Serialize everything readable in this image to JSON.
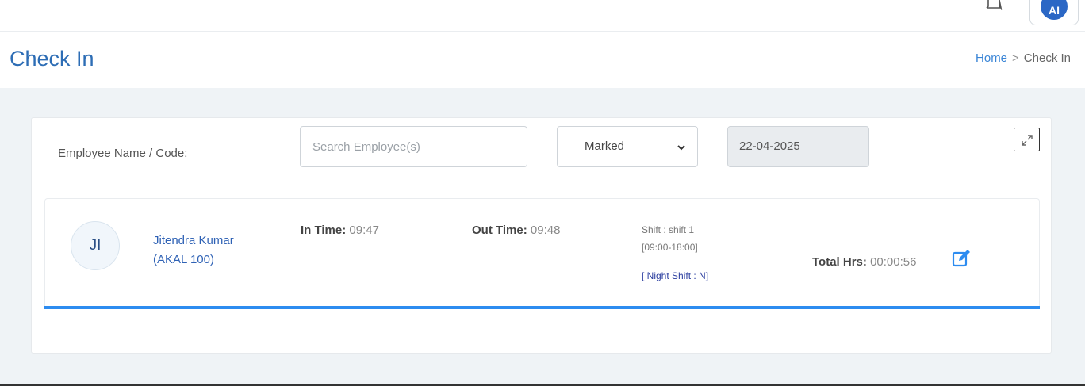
{
  "topbar": {
    "avatar_initials": "AI",
    "icons": [
      "bell-icon"
    ]
  },
  "header": {
    "title": "Check In",
    "breadcrumb": {
      "home": "Home",
      "separator": ">",
      "current": "Check In"
    }
  },
  "filters": {
    "label": "Employee Name / Code:",
    "search_placeholder": "Search Employee(s)",
    "search_value": "",
    "status_selected": "Marked",
    "date_value": "22-04-2025"
  },
  "employee": {
    "initials": "JI",
    "name": "Jitendra Kumar",
    "code": "(AKAL 100)",
    "in_time_label": "In Time:",
    "in_time": "09:47",
    "out_time_label": "Out Time:",
    "out_time": "09:48",
    "shift": "Shift : shift 1",
    "shift_hours": "[09:00-18:00]",
    "night_shift": "[ Night Shift : N]",
    "total_hrs_label": "Total Hrs:",
    "total_hrs": "00:00:56"
  },
  "colors": {
    "accent": "#2d6db5",
    "progress_bar": "#2d8cf0",
    "edit_icon": "#2d8cf0"
  }
}
